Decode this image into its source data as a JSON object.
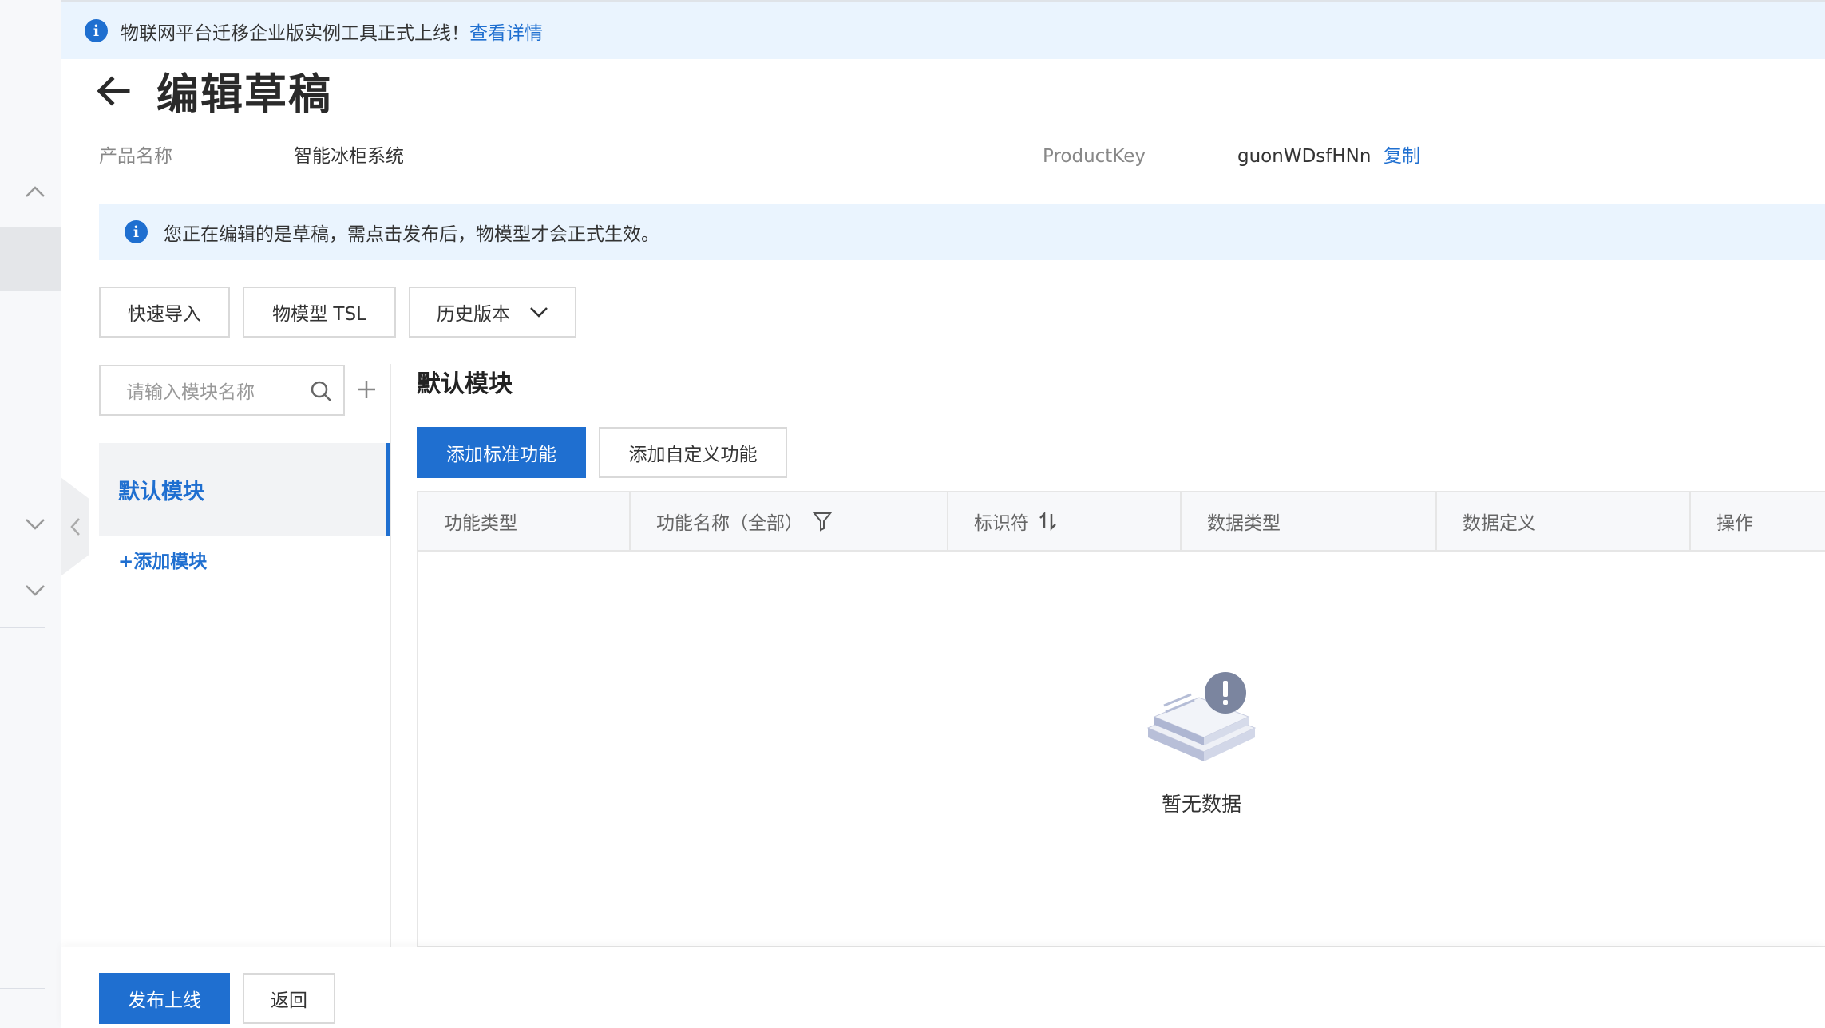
{
  "top_notice": {
    "text": "物联网平台迁移企业版实例工具正式上线！",
    "link": "查看详情"
  },
  "page": {
    "title": "编辑草稿"
  },
  "meta": {
    "product_name_label": "产品名称",
    "product_name_value": "智能冰柜系统",
    "product_key_label": "ProductKey",
    "product_key_value": "guonWDsfHNn",
    "copy_link": "复制"
  },
  "draft_notice": {
    "text": "您正在编辑的是草稿，需点击发布后，物模型才会正式生效。"
  },
  "toolbar": {
    "quick_import": "快速导入",
    "tsl": "物模型 TSL",
    "history": "历史版本"
  },
  "module_panel": {
    "search_placeholder": "请输入模块名称",
    "modules": [
      {
        "label": "默认模块",
        "selected": true
      }
    ],
    "add_module": "+添加模块"
  },
  "content": {
    "section_title": "默认模块",
    "add_standard": "添加标准功能",
    "add_custom": "添加自定义功能",
    "columns": [
      "功能类型",
      "功能名称（全部）",
      "标识符",
      "数据类型",
      "数据定义",
      "操作"
    ],
    "empty_text": "暂无数据"
  },
  "footer": {
    "publish": "发布上线",
    "back": "返回"
  },
  "colors": {
    "primary": "#1f6fd0",
    "notice_bg": "#eaf4fe"
  }
}
